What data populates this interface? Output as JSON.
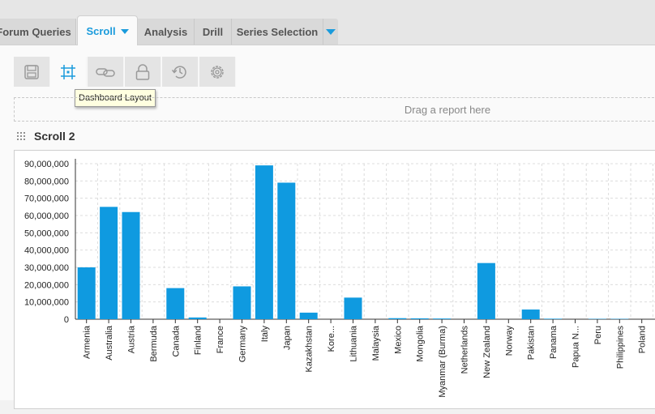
{
  "tabs": [
    {
      "label": "Forum Queries"
    },
    {
      "label": "Scroll"
    },
    {
      "label": "Analysis"
    },
    {
      "label": "Drill"
    },
    {
      "label": "Series Selection"
    }
  ],
  "tooltip": {
    "text": "Dashboard Layout"
  },
  "dropzone": {
    "text": "Drag a report here"
  },
  "report": {
    "title": "Scroll 2"
  },
  "colors": {
    "accent": "#1a9bdc",
    "bar": "#0f9ae0"
  },
  "toolbar": {
    "icons": [
      "save-icon",
      "layout-icon",
      "link-icon",
      "lock-icon",
      "history-icon",
      "settings-icon"
    ]
  },
  "chart_data": {
    "type": "bar",
    "categories": [
      "Armenia",
      "Australia",
      "Austria",
      "Bermuda",
      "Canada",
      "Finland",
      "France",
      "Germany",
      "Italy",
      "Japan",
      "Kazakhstan",
      "Kore...",
      "Lithuania",
      "Malaysia",
      "Mexico",
      "Mongolia",
      "Myanmar (Burma)",
      "Netherlands",
      "New Zealand",
      "Norway",
      "Pakistan",
      "Panama",
      "Papua N...",
      "Peru",
      "Philippines",
      "Poland"
    ],
    "values": [
      30000000,
      65000000,
      62000000,
      0,
      18000000,
      1000000,
      0,
      19000000,
      89000000,
      79000000,
      3800000,
      0,
      12500000,
      0,
      600000,
      500000,
      400000,
      0,
      32500000,
      0,
      5600000,
      300000,
      0,
      200000,
      200000,
      0
    ],
    "ylim": [
      0,
      90000000
    ],
    "yticks": [
      "0",
      "10,000,000",
      "20,000,000",
      "30,000,000",
      "40,000,000",
      "50,000,000",
      "60,000,000",
      "70,000,000",
      "80,000,000",
      "90,000,000"
    ],
    "grid": true
  }
}
